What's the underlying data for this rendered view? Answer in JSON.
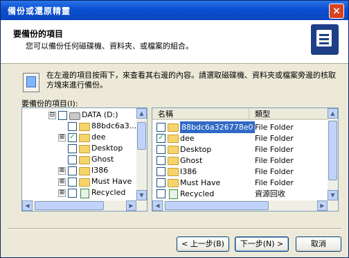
{
  "window": {
    "title": "備份或還原精靈",
    "close_label": "×"
  },
  "header": {
    "title": "要備份的項目",
    "subtitle": "您可以備份任何磁碟機、資料夾、或檔案的組合。"
  },
  "instructions": "在左邊的項目按兩下，來查看其右邊的內容。請選取磁碟機、資料夾或檔案旁邊的核取方塊來進行備份。",
  "select_label": "要備份的項目(I):",
  "tree": {
    "items": [
      {
        "expander": "⊟",
        "checked": false,
        "icon": "drive-icon",
        "label": "DATA (D:)"
      },
      {
        "expander": "",
        "checked": false,
        "icon": "folder-icon",
        "label": "88bdc6a3..."
      },
      {
        "expander": "⊞",
        "checked": true,
        "icon": "folder-icon",
        "label": "dee"
      },
      {
        "expander": "",
        "checked": false,
        "icon": "folder-icon",
        "label": "Desktop"
      },
      {
        "expander": "",
        "checked": false,
        "icon": "folder-icon",
        "label": "Ghost"
      },
      {
        "expander": "⊞",
        "checked": false,
        "icon": "folder-icon",
        "label": "I386"
      },
      {
        "expander": "⊞",
        "checked": false,
        "icon": "folder-icon",
        "label": "Must Have"
      },
      {
        "expander": "⊞",
        "checked": false,
        "icon": "recycle-bin-icon",
        "label": "Recycled"
      }
    ]
  },
  "list": {
    "columns": [
      "名稱",
      "類型"
    ],
    "rows": [
      {
        "checked": false,
        "icon": "folder-icon",
        "name": "88bdc6a326778e0",
        "type": "File Folder",
        "selected": true
      },
      {
        "checked": true,
        "icon": "folder-icon",
        "name": "dee",
        "type": "File Folder",
        "selected": false
      },
      {
        "checked": false,
        "icon": "folder-icon",
        "name": "Desktop",
        "type": "File Folder",
        "selected": false
      },
      {
        "checked": false,
        "icon": "folder-icon",
        "name": "Ghost",
        "type": "File Folder",
        "selected": false
      },
      {
        "checked": false,
        "icon": "folder-icon",
        "name": "I386",
        "type": "File Folder",
        "selected": false
      },
      {
        "checked": false,
        "icon": "folder-icon",
        "name": "Must Have",
        "type": "File Folder",
        "selected": false
      },
      {
        "checked": false,
        "icon": "recycle-bin-icon",
        "name": "Recycled",
        "type": "資源回收",
        "selected": false
      }
    ]
  },
  "buttons": {
    "back": "< 上一步(B)",
    "next": "下一步(N) >",
    "cancel": "取消"
  },
  "colors": {
    "titlebar": "#0a4fd0",
    "selection": "#316ac5",
    "check": "#21a121"
  }
}
